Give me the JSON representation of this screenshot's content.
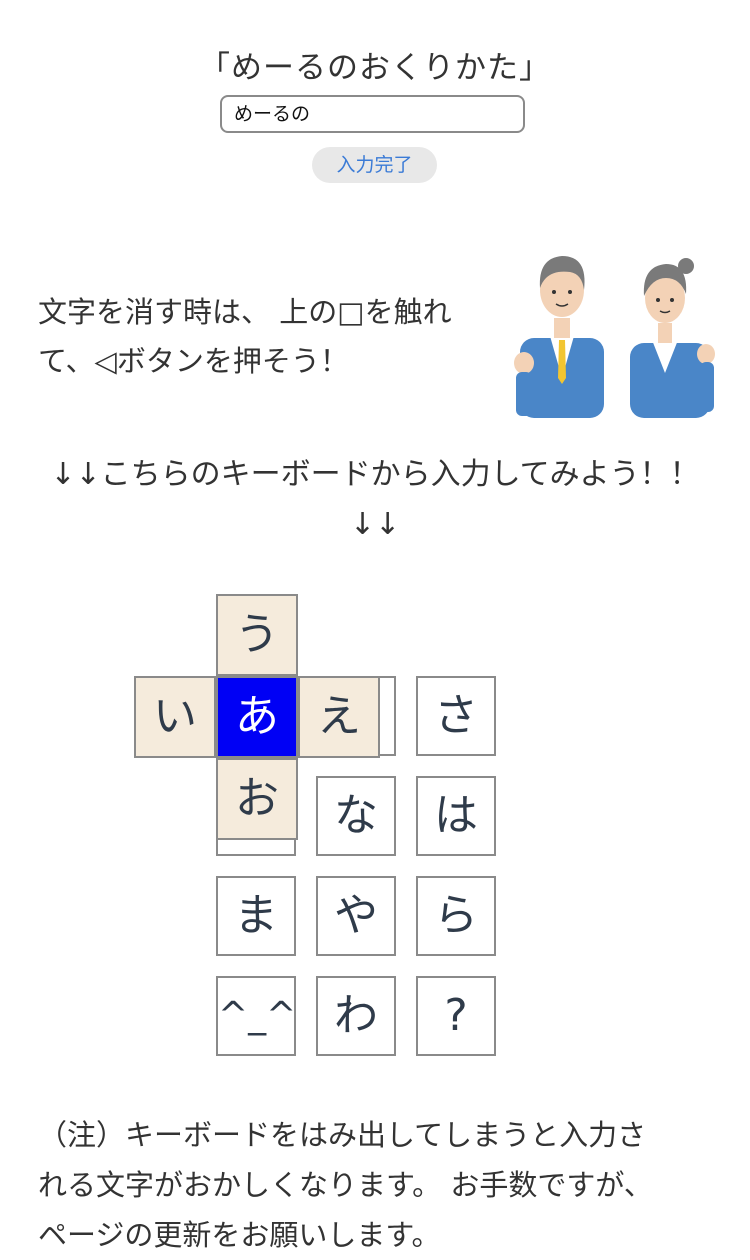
{
  "header": {
    "title": "「めーるのおくりかた」",
    "input_value": "めーるの",
    "done_label": "入力完了"
  },
  "instruction": {
    "line1": "文字を消す時は、 上の□を触れ",
    "line2": "て、◁ボタンを押そう！"
  },
  "prompt": {
    "line1": "↓↓こちらのキーボードから入力してみよう！！",
    "line2": "↓↓"
  },
  "keyboard": {
    "flick": {
      "up": "う",
      "left": "い",
      "center": "あ",
      "right": "え",
      "down": "お"
    },
    "keys": {
      "sa": "さ",
      "na": "な",
      "ha": "は",
      "ma": "ま",
      "ya": "や",
      "ra": "ら",
      "emote": "^_^",
      "wa": "わ",
      "question": "?"
    }
  },
  "note": {
    "line1": "（注）キーボードをはみ出してしまうと入力さ",
    "line2": "れる文字がおかしくなります。 お手数ですが、",
    "line3": "ページの更新をお願いします。"
  },
  "colors": {
    "active_key": "#0000f5",
    "flick_key": "#f5ebdc",
    "button_text": "#3b7bd6",
    "suit": "#4a86c8"
  }
}
